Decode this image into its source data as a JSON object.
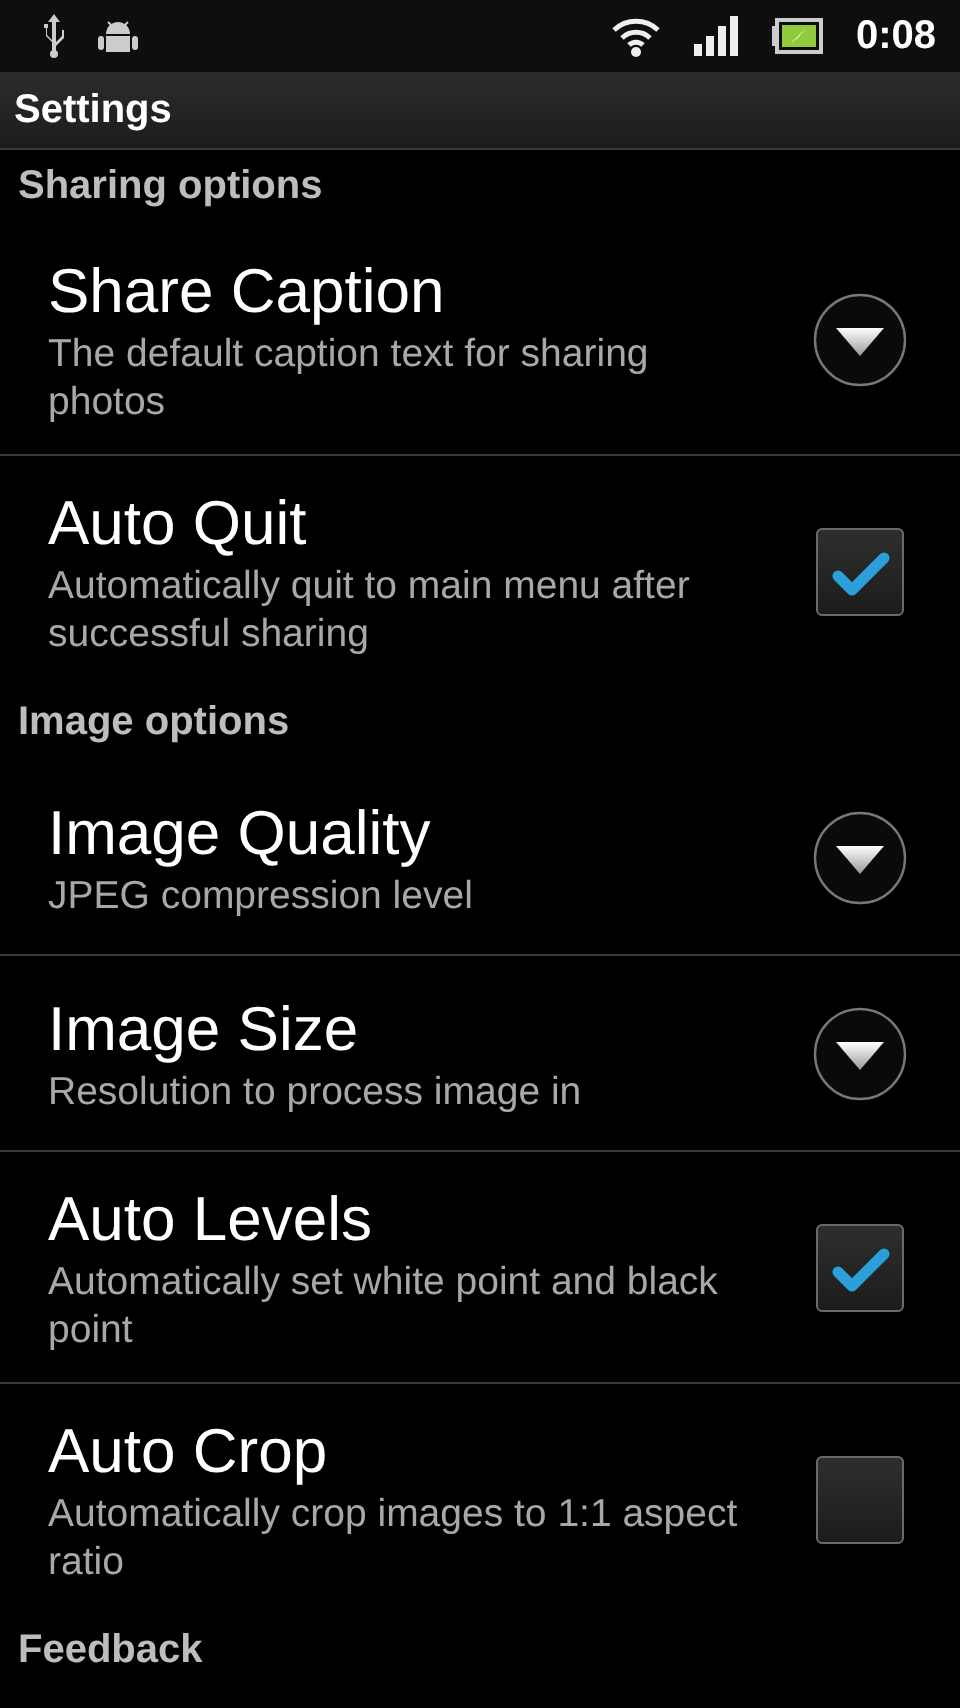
{
  "status_bar": {
    "time": "0:08"
  },
  "title": "Settings",
  "sections": [
    {
      "header": "Sharing options",
      "items": [
        {
          "kind": "list",
          "title": "Share Caption",
          "summary": "The default caption text for sharing photos"
        },
        {
          "kind": "checkbox",
          "title": "Auto Quit",
          "summary": "Automatically quit to main menu after successful sharing",
          "checked": true
        }
      ]
    },
    {
      "header": "Image options",
      "items": [
        {
          "kind": "list",
          "title": "Image Quality",
          "summary": "JPEG compression level"
        },
        {
          "kind": "list",
          "title": "Image Size",
          "summary": "Resolution to process image in"
        },
        {
          "kind": "checkbox",
          "title": "Auto Levels",
          "summary": "Automatically set white point and black point",
          "checked": true
        },
        {
          "kind": "checkbox",
          "title": "Auto Crop",
          "summary": "Automatically crop images to 1:1 aspect ratio",
          "checked": false
        }
      ]
    },
    {
      "header": "Feedback"
    }
  ]
}
